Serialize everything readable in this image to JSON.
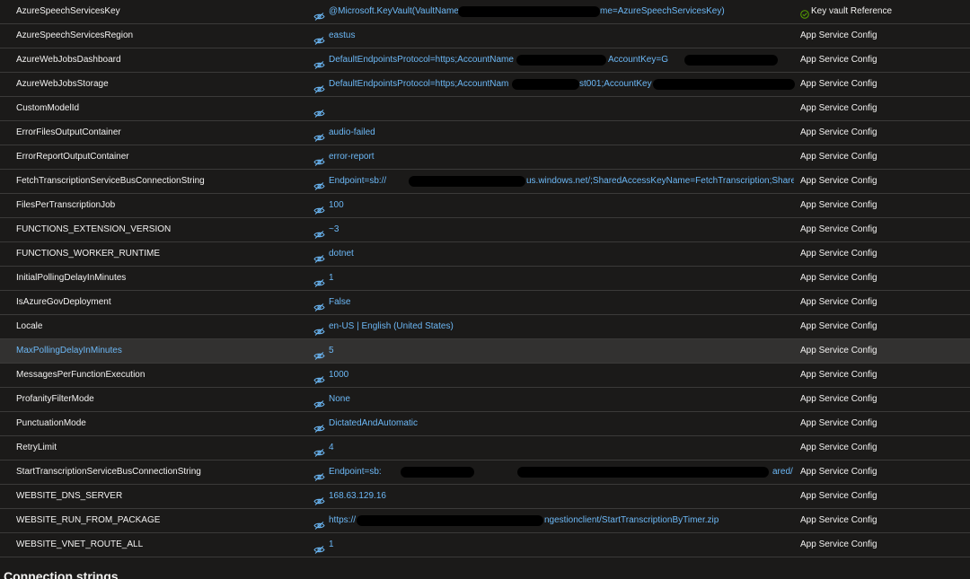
{
  "settings": [
    {
      "name": "AzureSpeechServicesKey",
      "value": "@Microsoft.KeyVault(VaultName",
      "value_tail": "me=AzureSpeechServicesKey)",
      "source": "Key vault Reference",
      "source_icon": "check-circle-icon"
    },
    {
      "name": "AzureSpeechServicesRegion",
      "value": "eastus",
      "source": "App Service Config"
    },
    {
      "name": "AzureWebJobsDashboard",
      "value": "DefaultEndpointsProtocol=https;AccountName",
      "value_tail": "AccountKey=G",
      "source": "App Service Config"
    },
    {
      "name": "AzureWebJobsStorage",
      "value": "DefaultEndpointsProtocol=https;AccountNam",
      "value_tail": "st001;AccountKey",
      "source": "App Service Config"
    },
    {
      "name": "CustomModelId",
      "value": "",
      "source": "App Service Config"
    },
    {
      "name": "ErrorFilesOutputContainer",
      "value": "audio-failed",
      "source": "App Service Config"
    },
    {
      "name": "ErrorReportOutputContainer",
      "value": "error-report",
      "source": "App Service Config"
    },
    {
      "name": "FetchTranscriptionServiceBusConnectionString",
      "value": "Endpoint=sb://",
      "value_tail": "us.windows.net/;SharedAccessKeyName=FetchTranscription;Shared",
      "source": "App Service Config"
    },
    {
      "name": "FilesPerTranscriptionJob",
      "value": "100",
      "source": "App Service Config"
    },
    {
      "name": "FUNCTIONS_EXTENSION_VERSION",
      "value": "~3",
      "source": "App Service Config"
    },
    {
      "name": "FUNCTIONS_WORKER_RUNTIME",
      "value": "dotnet",
      "source": "App Service Config"
    },
    {
      "name": "InitialPollingDelayInMinutes",
      "value": "1",
      "source": "App Service Config"
    },
    {
      "name": "IsAzureGovDeployment",
      "value": "False",
      "source": "App Service Config"
    },
    {
      "name": "Locale",
      "value": "en-US | English (United States)",
      "source": "App Service Config"
    },
    {
      "name": "MaxPollingDelayInMinutes",
      "value": "5",
      "source": "App Service Config",
      "selected": true
    },
    {
      "name": "MessagesPerFunctionExecution",
      "value": "1000",
      "source": "App Service Config"
    },
    {
      "name": "ProfanityFilterMode",
      "value": "None",
      "source": "App Service Config"
    },
    {
      "name": "PunctuationMode",
      "value": "DictatedAndAutomatic",
      "source": "App Service Config"
    },
    {
      "name": "RetryLimit",
      "value": "4",
      "source": "App Service Config"
    },
    {
      "name": "StartTranscriptionServiceBusConnectionString",
      "value": "Endpoint=sb:",
      "value_tail": "ared/",
      "source": "App Service Config"
    },
    {
      "name": "WEBSITE_DNS_SERVER",
      "value": "168.63.129.16",
      "source": "App Service Config"
    },
    {
      "name": "WEBSITE_RUN_FROM_PACKAGE",
      "value": "https://",
      "value_tail": "ngestionclient/StartTranscriptionByTimer.zip",
      "source": "App Service Config"
    },
    {
      "name": "WEBSITE_VNET_ROUTE_ALL",
      "value": "1",
      "source": "App Service Config"
    }
  ],
  "connection_strings_heading": "Connection strings",
  "icons": {
    "hidden_value": "eye-slash-icon",
    "key_vault_ok": "check-circle-icon"
  },
  "colors": {
    "background": "#1b1a19",
    "link": "#6cb8f6",
    "text": "#f3f2f1",
    "divider": "#3b3a39",
    "success": "#57a300",
    "selected_row": "#323130"
  }
}
